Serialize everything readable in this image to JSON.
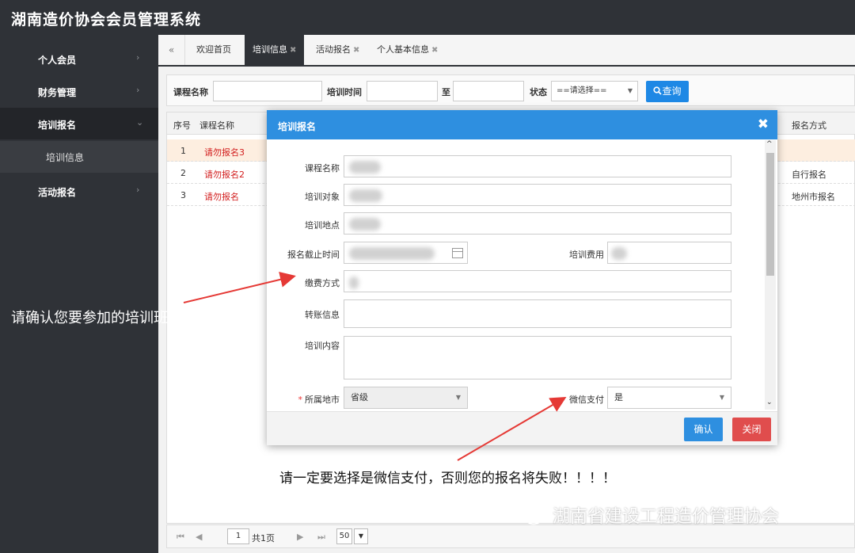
{
  "app": {
    "title": "湖南造价协会会员管理系统"
  },
  "sidebar": {
    "items": [
      {
        "label": "个人会员",
        "chevron": "›"
      },
      {
        "label": "财务管理",
        "chevron": "›"
      },
      {
        "label": "培训报名",
        "chevron": "⌄",
        "sub": "培训信息"
      },
      {
        "label": "活动报名",
        "chevron": "›"
      }
    ]
  },
  "tabs": {
    "nav": "«",
    "items": [
      {
        "label": "欢迎首页",
        "close": ""
      },
      {
        "label": "培训信息",
        "close": "✖"
      },
      {
        "label": "活动报名",
        "close": "✖"
      },
      {
        "label": "个人基本信息",
        "close": "✖"
      }
    ]
  },
  "search": {
    "course_label": "课程名称",
    "time_label": "培训时间",
    "to_label": "至",
    "status_label": "状态",
    "status_value": "==请选择==",
    "query_label": "查询"
  },
  "grid": {
    "headers": {
      "no": "序号",
      "name": "课程名称",
      "way": "报名方式"
    },
    "rows": [
      {
        "no": "1",
        "name": "请勿报名3",
        "way": ""
      },
      {
        "no": "2",
        "name": "请勿报名2",
        "way": "自行报名"
      },
      {
        "no": "3",
        "name": "请勿报名",
        "way": "地州市报名"
      }
    ]
  },
  "pager": {
    "page": "1",
    "total": "共1页",
    "size": "50"
  },
  "dialog": {
    "title": "培训报名",
    "close": "✖",
    "fields": {
      "course_name": "课程名称",
      "target": "培训对象",
      "location": "培训地点",
      "deadline": "报名截止时间",
      "fee": "培训费用",
      "pay_method": "缴费方式",
      "transfer": "转账信息",
      "content": "培训内容",
      "city": "所属地市",
      "city_value": "省级",
      "wechat_pay": "微信支付",
      "wechat_pay_value": "是"
    },
    "scroll_up": "^",
    "scroll_down": "⌄",
    "ok": "确认",
    "cancel": "关闭"
  },
  "annotations": {
    "left": "请确认您要参加的培训班信息",
    "bottom": "请一定要选择是微信支付，否则您的报名将失败！！！！"
  },
  "watermark": "湖南省建设工程造价管理协会",
  "colors": {
    "primary": "#2e8fe0",
    "danger": "#e04d4d",
    "sidebar": "#2f3237",
    "link_red": "#d21d1d"
  }
}
